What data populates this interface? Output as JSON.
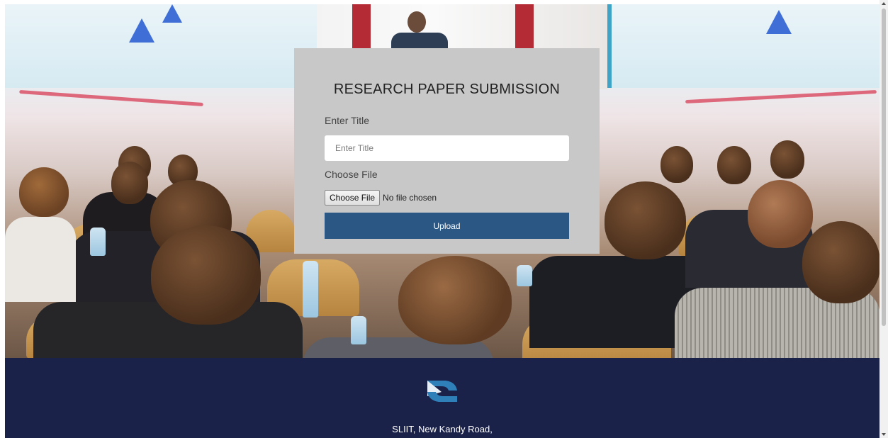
{
  "hero": {
    "image": "conference-audience-photo"
  },
  "form": {
    "title": "RESEARCH PAPER SUBMISSION",
    "title_label": "Enter Title",
    "title_input_placeholder": "Enter Title",
    "title_input_value": "",
    "file_label": "Choose File",
    "file_button_label": "Choose File",
    "file_status": "No file chosen",
    "upload_label": "Upload"
  },
  "footer": {
    "logo_icon": "organization-logo-icon",
    "address": "SLIIT, New Kandy Road,"
  },
  "colors": {
    "form_card_bg": "#c8c8c8",
    "upload_button_bg": "#2b5784",
    "footer_bg": "#1b224a"
  }
}
